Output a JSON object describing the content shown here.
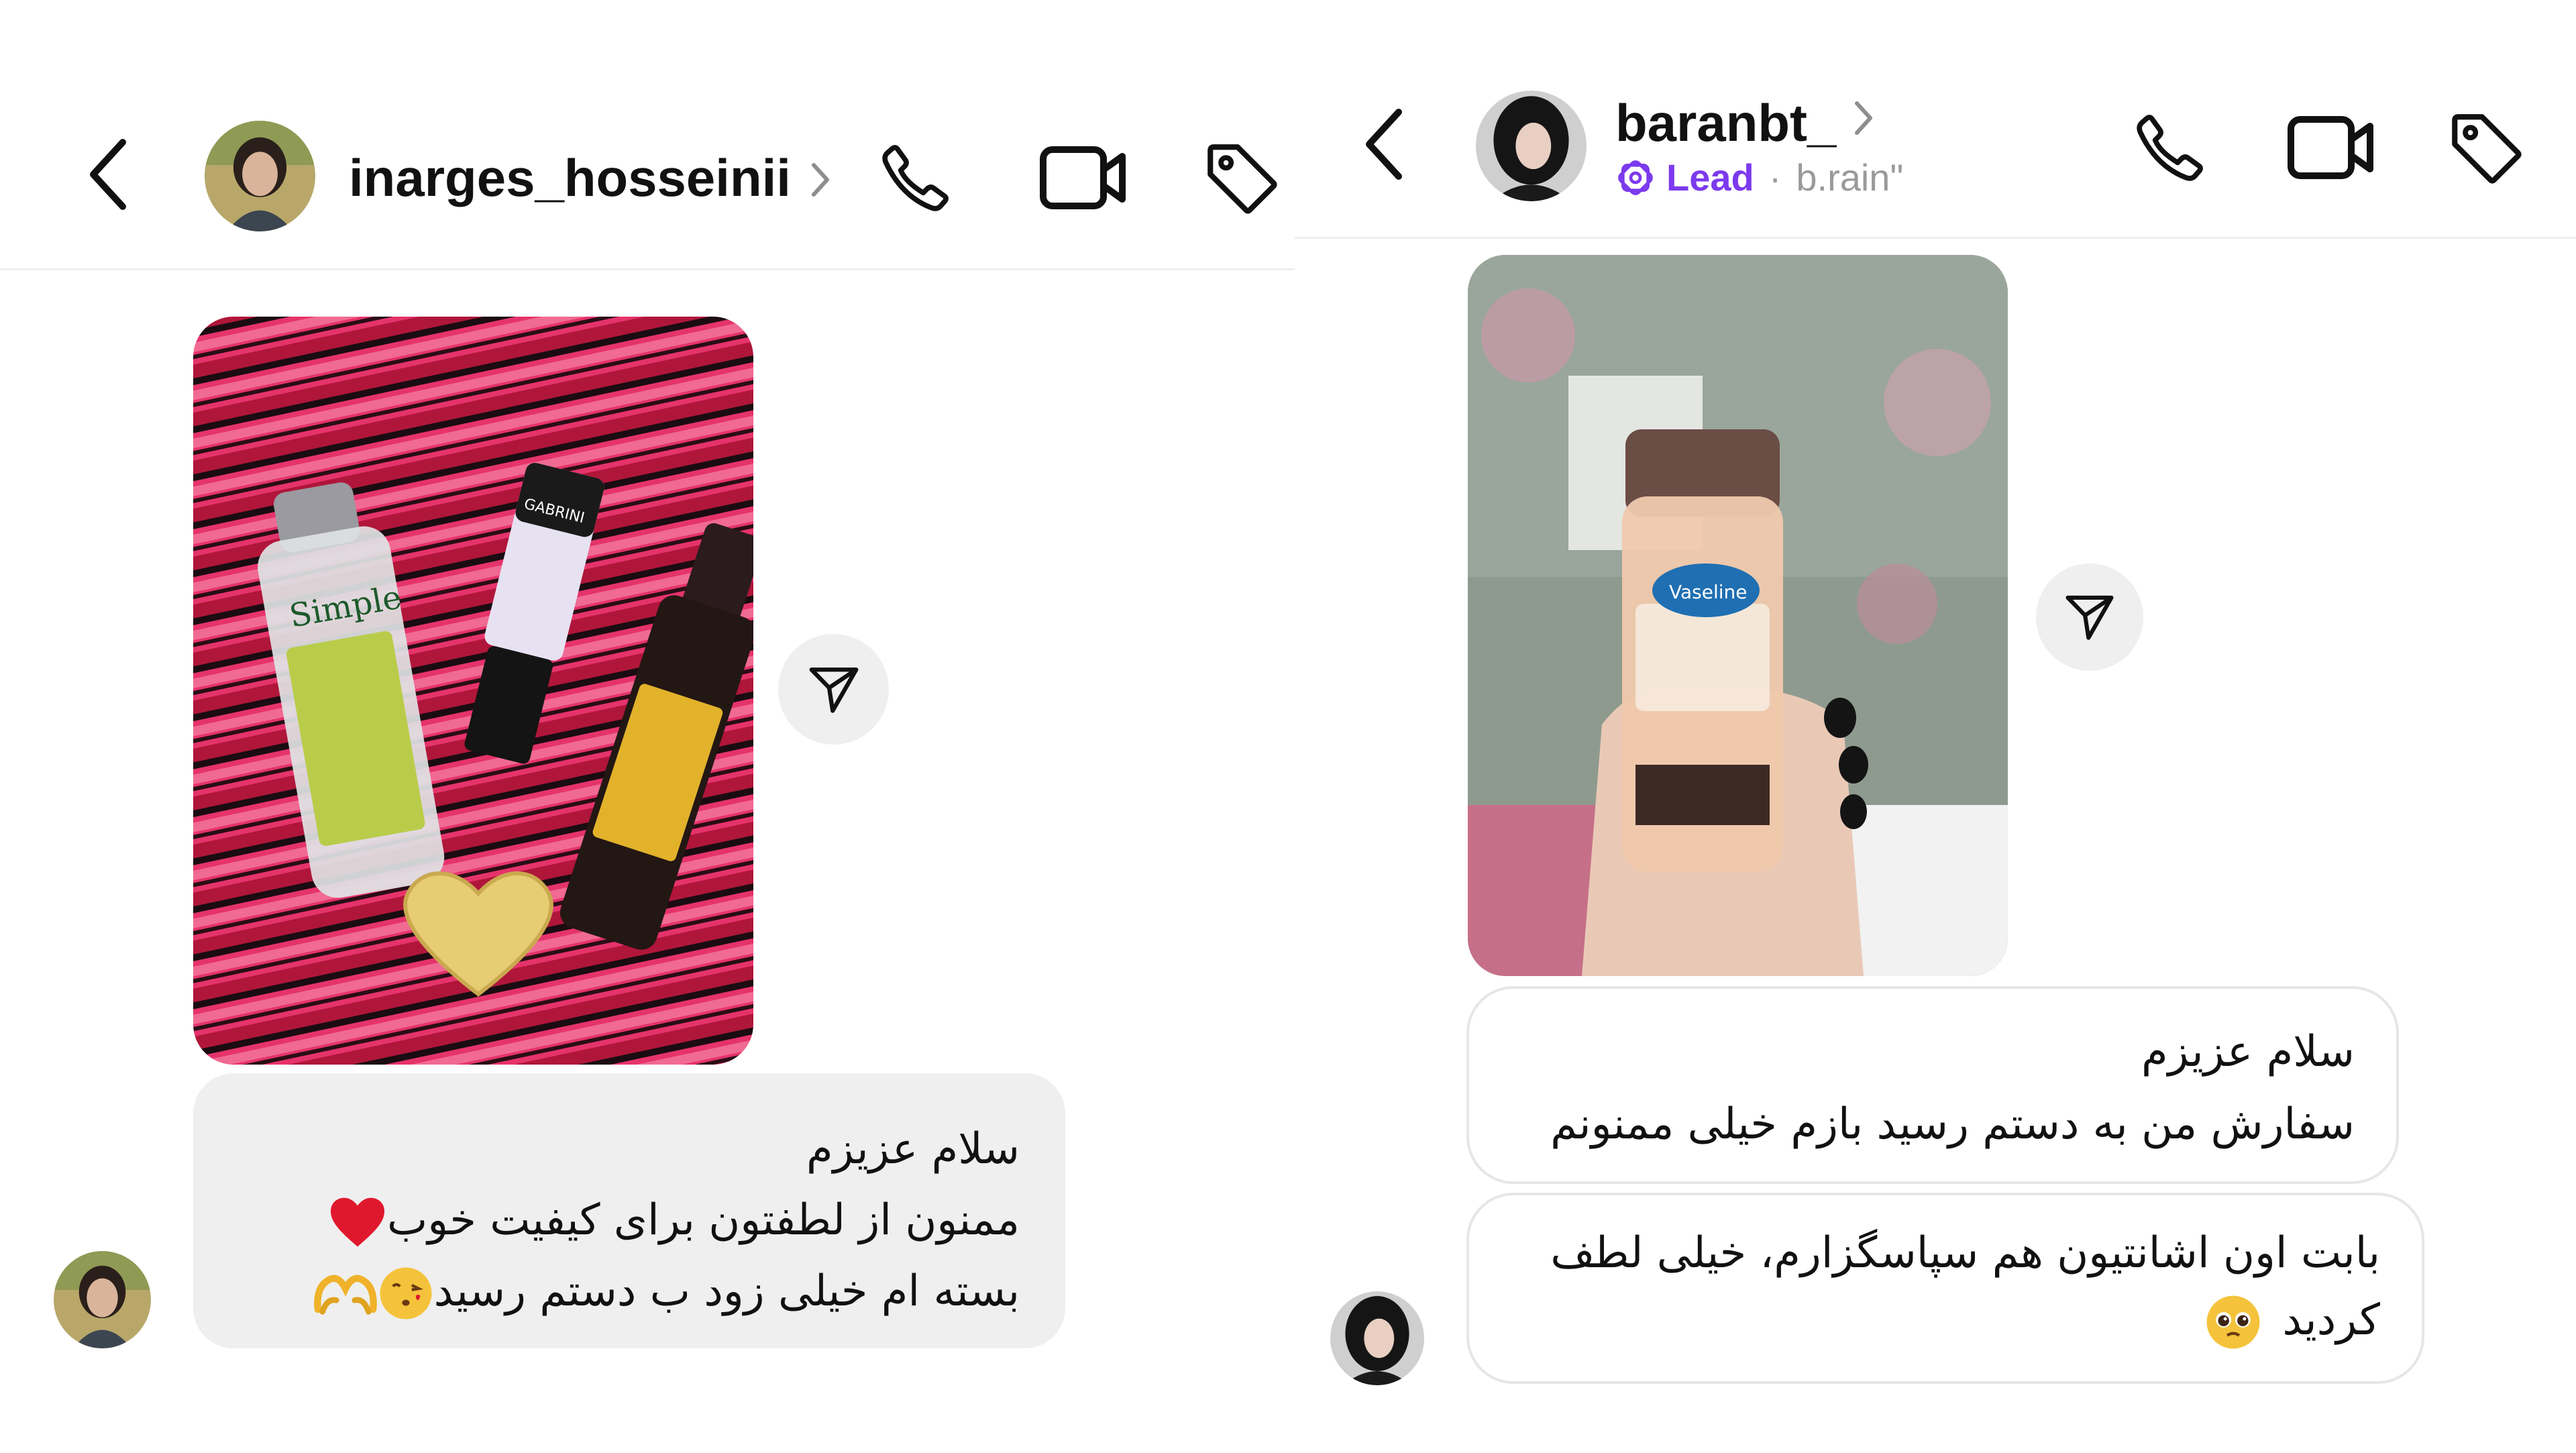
{
  "left_chat": {
    "header": {
      "username": "inarges_hosseinii"
    },
    "message": {
      "line1": "سلام عزیزم",
      "line2": "ممنون از لطفتون برای کیفیت خوب",
      "line3": "بسته ام خیلی زود ب دستم رسید"
    }
  },
  "right_chat": {
    "header": {
      "username": "baranbt_",
      "label": "Lead",
      "separator": "·",
      "handle": "b.rain\""
    },
    "message1": {
      "line1": "سلام عزیزم",
      "line2": "سفارش من به دستم رسید بازم خیلی ممنونم"
    },
    "message2": {
      "line1": "بابت اون اشانتیون هم سپاسگزارم، خیلی لطف",
      "line2": "کردید"
    }
  },
  "icons": {
    "left_header": [
      "back-arrow-icon",
      "chevron-right-icon",
      "phone-icon",
      "video-camera-icon",
      "tag-icon"
    ],
    "right_header": [
      "back-arrow-icon",
      "chevron-right-icon",
      "lead-label-icon",
      "phone-icon",
      "video-camera-icon",
      "tag-icon"
    ],
    "messages": [
      "share-icon",
      "red-heart-emoji",
      "kissing-face-emoji",
      "heart-hands-emoji",
      "pleading-face-emoji"
    ]
  },
  "colors": {
    "lead_purple": "#7c3aed",
    "bubble_gray": "#efefef",
    "divider": "#efefef",
    "secondary_text": "#9a9a9a"
  }
}
